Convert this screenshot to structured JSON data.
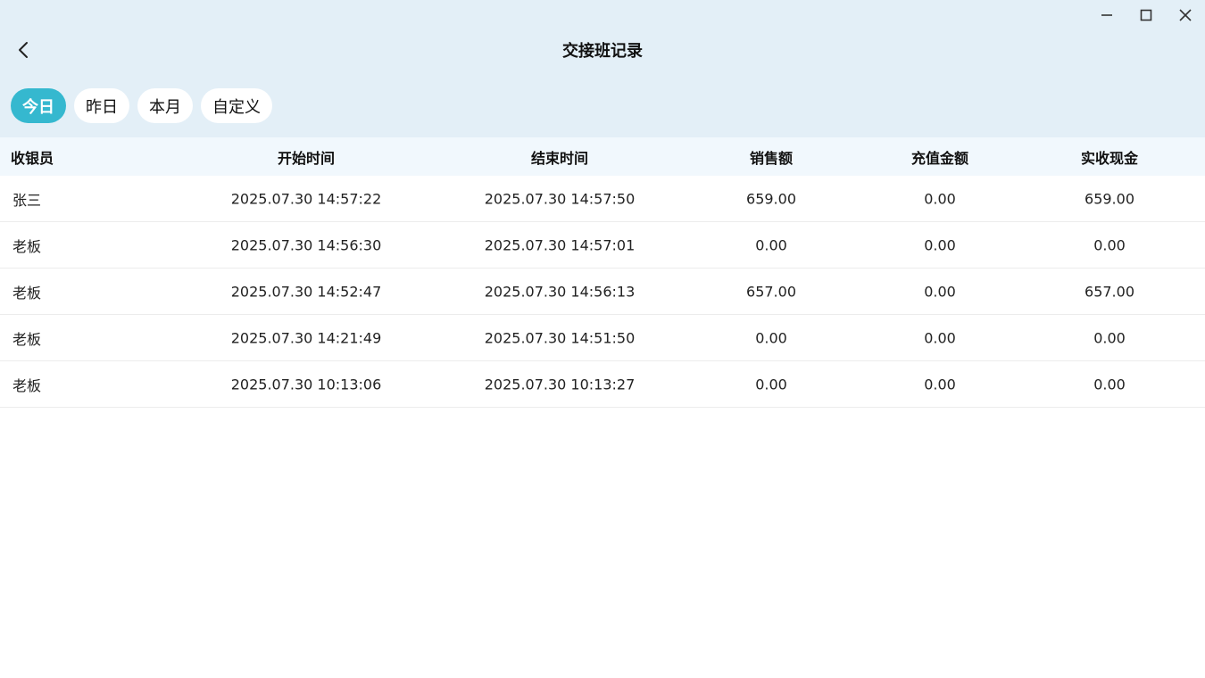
{
  "header": {
    "title": "交接班记录",
    "back_icon": "chevron-left-icon"
  },
  "window_controls": {
    "minimize_icon": "minimize-icon",
    "maximize_icon": "maximize-icon",
    "close_icon": "close-icon"
  },
  "filters": {
    "selected": "今日",
    "items": [
      {
        "label": "今日"
      },
      {
        "label": "昨日"
      },
      {
        "label": "本月"
      },
      {
        "label": "自定义"
      }
    ]
  },
  "table": {
    "columns": [
      "收银员",
      "开始时间",
      "结束时间",
      "销售额",
      "充值金额",
      "实收现金"
    ],
    "rows": [
      {
        "cashier": "张三",
        "start": "2025.07.30 14:57:22",
        "end": "2025.07.30 14:57:50",
        "sales": "659.00",
        "recharge": "0.00",
        "cash": "659.00"
      },
      {
        "cashier": "老板",
        "start": "2025.07.30 14:56:30",
        "end": "2025.07.30 14:57:01",
        "sales": "0.00",
        "recharge": "0.00",
        "cash": "0.00"
      },
      {
        "cashier": "老板",
        "start": "2025.07.30 14:52:47",
        "end": "2025.07.30 14:56:13",
        "sales": "657.00",
        "recharge": "0.00",
        "cash": "657.00"
      },
      {
        "cashier": "老板",
        "start": "2025.07.30 14:21:49",
        "end": "2025.07.30 14:51:50",
        "sales": "0.00",
        "recharge": "0.00",
        "cash": "0.00"
      },
      {
        "cashier": "老板",
        "start": "2025.07.30 10:13:06",
        "end": "2025.07.30 10:13:27",
        "sales": "0.00",
        "recharge": "0.00",
        "cash": "0.00"
      }
    ]
  },
  "colors": {
    "header_bg": "#e3eff7",
    "accent": "#35b8cf",
    "table_head_bg": "#f1f8fd"
  }
}
